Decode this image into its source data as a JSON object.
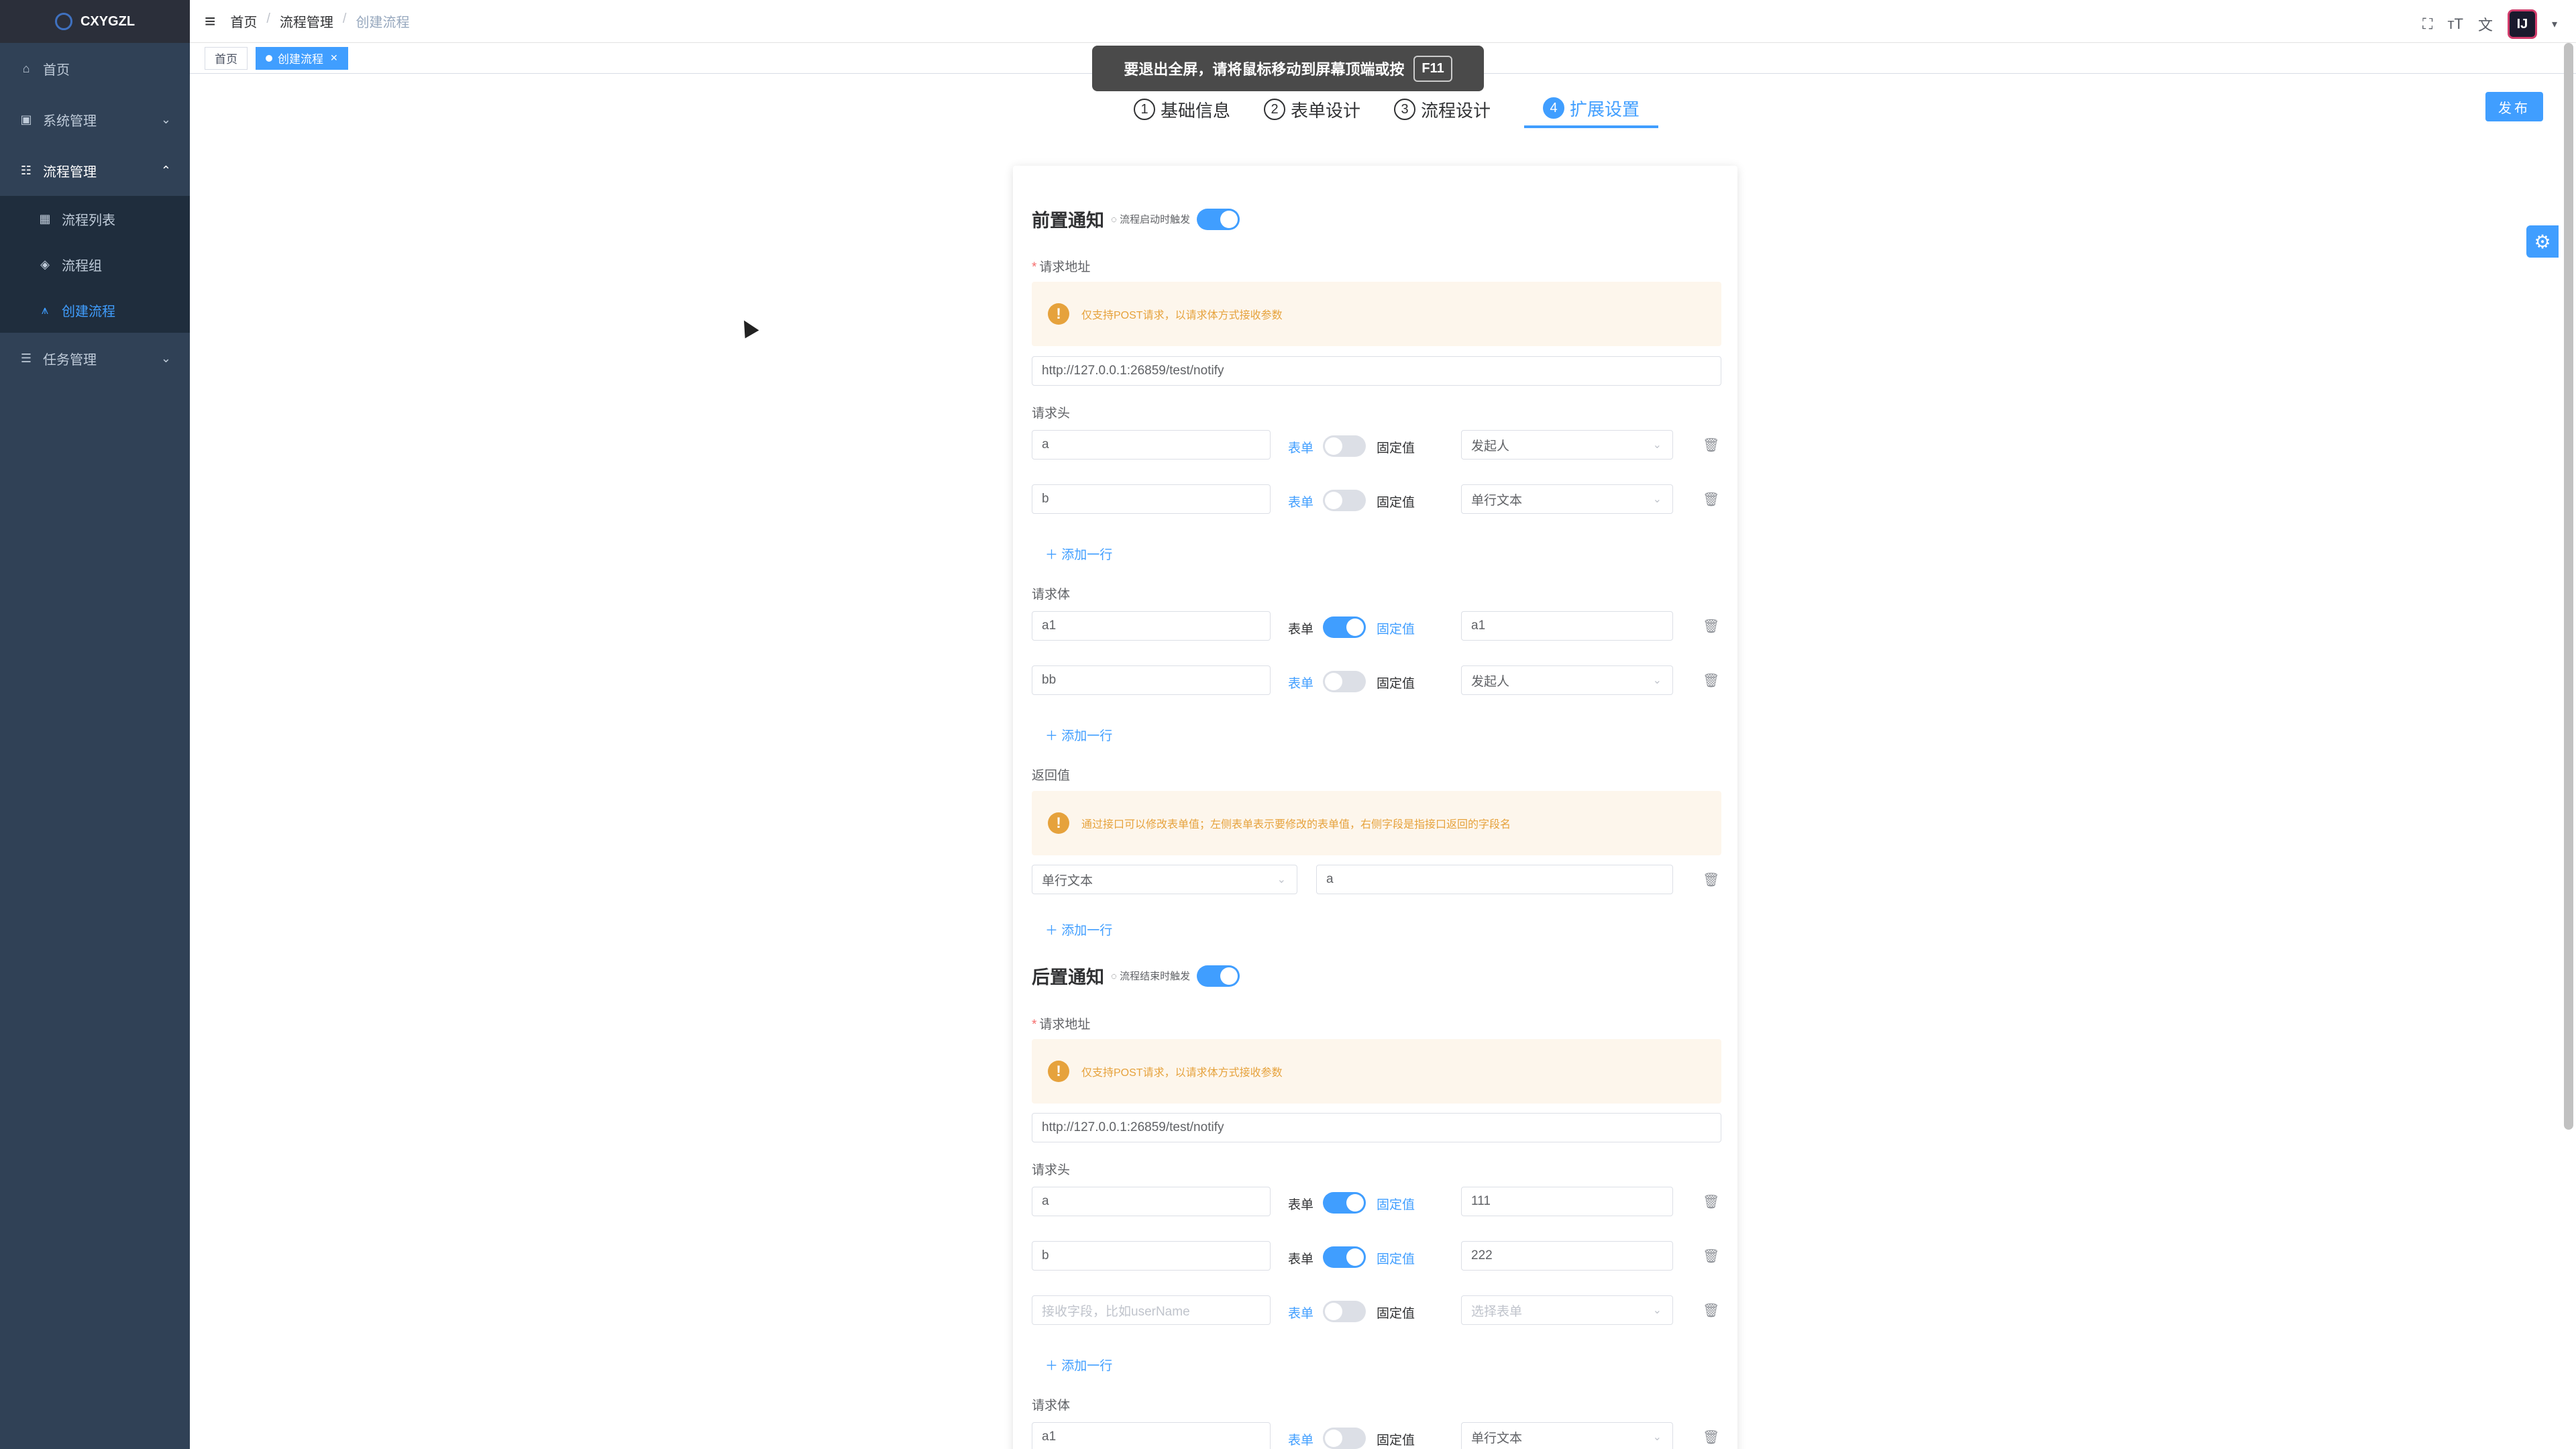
{
  "app": {
    "logo": "CXYGZL"
  },
  "sidebar": {
    "items": [
      {
        "label": "首页",
        "icon": "home-icon"
      },
      {
        "label": "系统管理",
        "icon": "system-icon"
      },
      {
        "label": "流程管理",
        "icon": "process-icon"
      },
      {
        "label": "任务管理",
        "icon": "task-icon"
      }
    ],
    "sub_items": [
      {
        "label": "流程列表"
      },
      {
        "label": "流程组"
      },
      {
        "label": "创建流程"
      }
    ]
  },
  "breadcrumb": [
    "首页",
    "流程管理",
    "创建流程"
  ],
  "tags": [
    "首页",
    "创建流程"
  ],
  "toast": {
    "text": "要退出全屏，请将鼠标移动到屏幕顶端或按",
    "key": "F11"
  },
  "steps": [
    {
      "num": "1",
      "label": "基础信息"
    },
    {
      "num": "2",
      "label": "表单设计"
    },
    {
      "num": "3",
      "label": "流程设计"
    },
    {
      "num": "4",
      "label": "扩展设置"
    }
  ],
  "publish": "发布",
  "pre": {
    "title": "前置通知",
    "hint": "◌ 流程启动时触发",
    "enabled": true,
    "url_label": "请求地址",
    "alert": "仅支持POST请求，以请求体方式接收参数",
    "url": "http://127.0.0.1:26859/test/notify",
    "headers_label": "请求头",
    "headers": [
      {
        "key": "a",
        "form_label": "表单",
        "fixed_label": "固定值",
        "fixed": false,
        "value": "发起人"
      },
      {
        "key": "b",
        "form_label": "表单",
        "fixed_label": "固定值",
        "fixed": false,
        "value": "单行文本"
      }
    ],
    "add_row": "添加一行",
    "body_label": "请求体",
    "body": [
      {
        "key": "a1",
        "form_label": "表单",
        "fixed_label": "固定值",
        "fixed": true,
        "value": "a1"
      },
      {
        "key": "bb",
        "form_label": "表单",
        "fixed_label": "固定值",
        "fixed": false,
        "value": "发起人"
      }
    ],
    "return_label": "返回值",
    "return_alert": "通过接口可以修改表单值；左侧表单表示要修改的表单值，右侧字段是指接口返回的字段名",
    "return_rows": [
      {
        "field": "单行文本",
        "value": "a"
      }
    ]
  },
  "post": {
    "title": "后置通知",
    "hint": "◌ 流程结束时触发",
    "enabled": true,
    "url_label": "请求地址",
    "alert": "仅支持POST请求，以请求体方式接收参数",
    "url": "http://127.0.0.1:26859/test/notify",
    "headers_label": "请求头",
    "headers": [
      {
        "key": "a",
        "form_label": "表单",
        "fixed_label": "固定值",
        "fixed": true,
        "value": "111"
      },
      {
        "key": "b",
        "form_label": "表单",
        "fixed_label": "固定值",
        "fixed": true,
        "value": "222"
      },
      {
        "key_placeholder": "接收字段，比如userName",
        "form_label": "表单",
        "fixed_label": "固定值",
        "fixed": false,
        "value_placeholder": "选择表单"
      }
    ],
    "add_row": "添加一行",
    "body_label": "请求体",
    "body": [
      {
        "key": "a1",
        "form_label": "表单",
        "fixed_label": "固定值",
        "fixed": false,
        "value": "单行文本"
      }
    ]
  },
  "colors": {
    "primary": "#409eff",
    "sidebar_bg": "#304156",
    "warning": "#e6a23c"
  }
}
